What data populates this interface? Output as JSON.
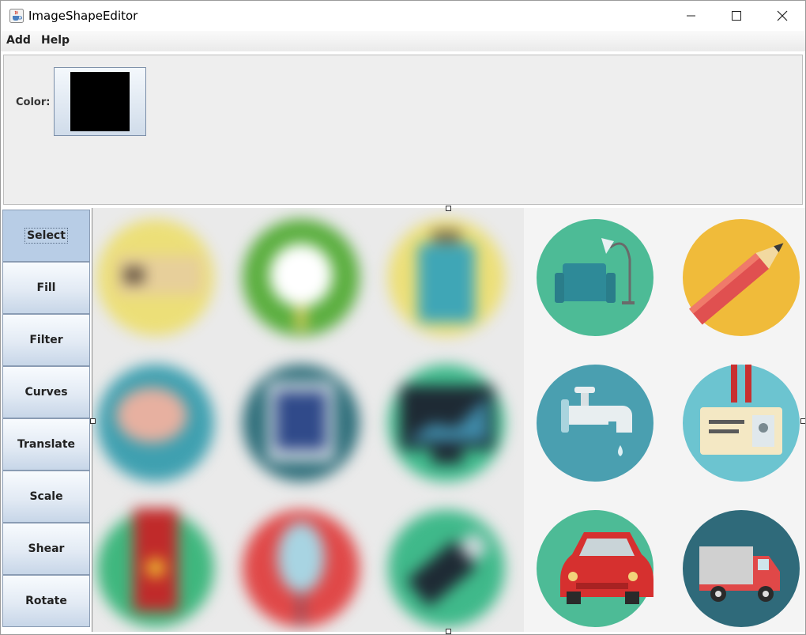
{
  "window": {
    "title": "ImageShapeEditor",
    "icons": [
      "java-cup-icon",
      "minimize-icon",
      "maximize-icon",
      "close-icon"
    ]
  },
  "menu": {
    "items": [
      {
        "label": "Add"
      },
      {
        "label": "Help"
      }
    ]
  },
  "color_panel": {
    "label": "Color:",
    "selected_color": "#000000"
  },
  "tools": [
    {
      "label": "Select",
      "selected": true
    },
    {
      "label": "Fill"
    },
    {
      "label": "Filter"
    },
    {
      "label": "Curves"
    },
    {
      "label": "Translate"
    },
    {
      "label": "Scale"
    },
    {
      "label": "Shear"
    },
    {
      "label": "Rotate"
    }
  ],
  "canvas": {
    "filter_region": "blurred",
    "icons": [
      {
        "name": "ticket-icon",
        "bg": "#ecdf78",
        "blurred": true
      },
      {
        "name": "donut-icon",
        "bg": "#5aae3e",
        "blurred": true
      },
      {
        "name": "suitcase-icon",
        "bg": "#ecdf78",
        "blurred": true
      },
      {
        "name": "armchair-lamp-icon",
        "bg": "#4dbb96",
        "blurred": false
      },
      {
        "name": "pencil-icon",
        "bg": "#f0bb3a",
        "blurred": false
      },
      {
        "name": "brain-icon",
        "bg": "#3fa0b0",
        "blurred": true
      },
      {
        "name": "tablet-icon",
        "bg": "#2e6e7a",
        "blurred": true
      },
      {
        "name": "monitor-chart-icon",
        "bg": "#3fba8c",
        "blurred": true
      },
      {
        "name": "faucet-icon",
        "bg": "#4a9fb0",
        "blurred": false
      },
      {
        "name": "id-badge-icon",
        "bg": "#6cc4d0",
        "blurred": false
      },
      {
        "name": "bookmark-icon",
        "bg": "#3fb77e",
        "blurred": true
      },
      {
        "name": "mouse-icon",
        "bg": "#e04848",
        "blurred": true
      },
      {
        "name": "usb-drive-icon",
        "bg": "#3fb98a",
        "blurred": true
      },
      {
        "name": "car-icon",
        "bg": "#4dbb96",
        "blurred": false
      },
      {
        "name": "truck-icon",
        "bg": "#2f6a7a",
        "blurred": false
      }
    ]
  }
}
